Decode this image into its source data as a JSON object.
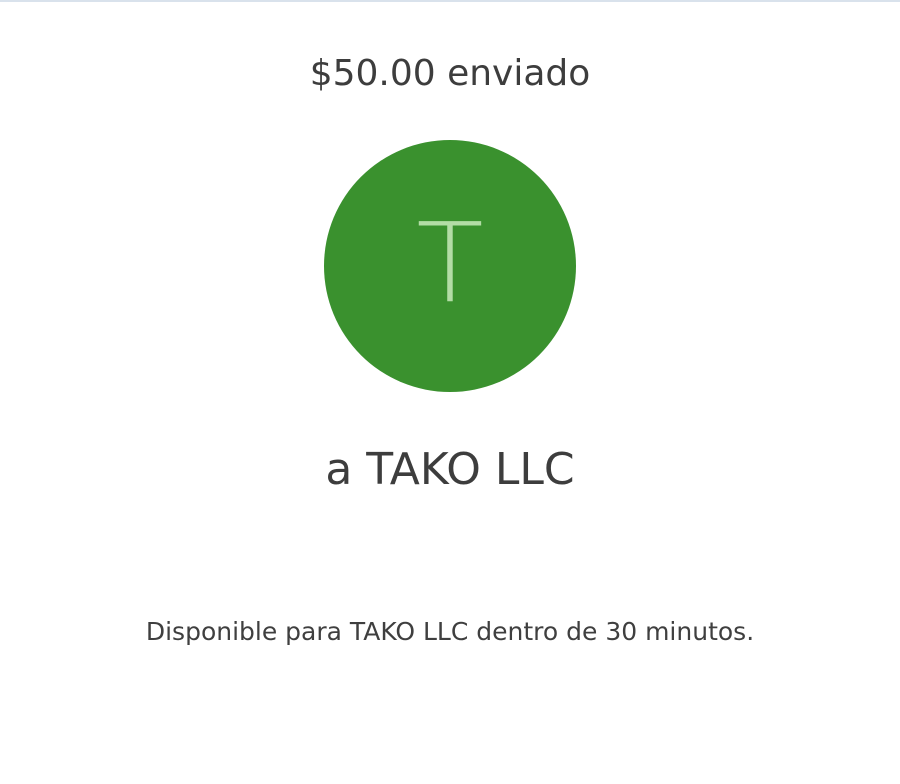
{
  "confirmation": {
    "amount_title": "$50.00 enviado",
    "avatar_initial": "T",
    "avatar_color": "#3a912e",
    "avatar_letter_color": "#b3dda6",
    "recipient_line": "a TAKO LLC",
    "availability_note": "Disponible para TAKO LLC dentro de 30 minutos."
  }
}
